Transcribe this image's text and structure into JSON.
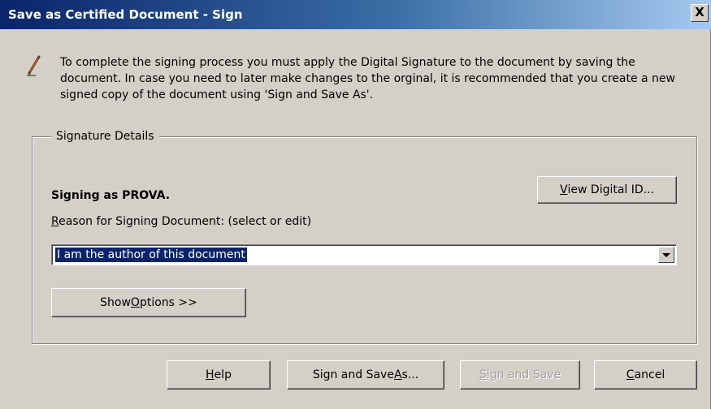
{
  "window": {
    "title": "Save as Certified Document - Sign",
    "close_label": "X"
  },
  "intro": {
    "icon": "pen-icon",
    "text": "To complete the signing process you must apply the Digital Signature to the document by saving the document. In case you need to later make changes to the orginal, it is recommended that you create a new signed copy of the document using 'Sign and Save As'."
  },
  "signature_details": {
    "legend": "Signature Details",
    "signing_as": "Signing as PROVA.",
    "view_id_button": {
      "accel": "V",
      "rest": "iew Digital ID..."
    },
    "reason_label": {
      "accel": "R",
      "rest": "eason for Signing Document: (select or edit)"
    },
    "reason_value": "I am the author of this document",
    "show_options_button": {
      "pre": "Show ",
      "accel": "O",
      "rest": "ptions >>"
    }
  },
  "footer": {
    "help_button": {
      "accel": "H",
      "rest": "elp"
    },
    "sign_save_as_button": {
      "pre": "Sign and Save ",
      "accel": "A",
      "rest": "s..."
    },
    "sign_save_button": {
      "accel": "S",
      "rest": "ign and Save",
      "enabled": false
    },
    "cancel_button": {
      "accel": "C",
      "rest": "ancel"
    }
  },
  "colors": {
    "titlebar_start": "#0a246a",
    "titlebar_end": "#a6caf0",
    "dialog_bg": "#d4d0c8",
    "selection_bg": "#0a246a"
  }
}
